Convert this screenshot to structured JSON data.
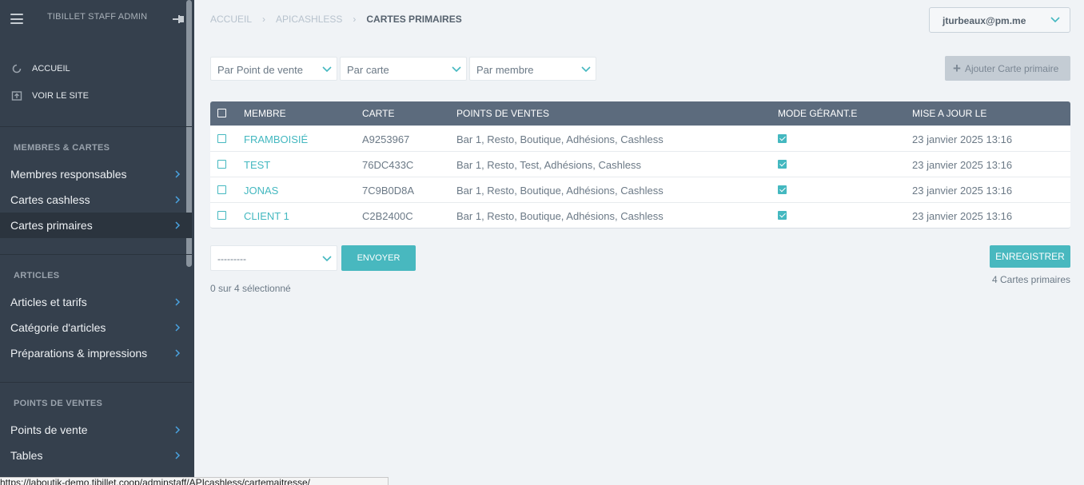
{
  "sidebar": {
    "title": "TIBILLET STAFF ADMIN",
    "links": [
      {
        "label": "ACCUEIL",
        "icon": "refresh-icon"
      },
      {
        "label": "VOIR LE SITE",
        "icon": "external-icon"
      }
    ],
    "sections": [
      {
        "title": "MEMBRES & CARTES",
        "items": [
          "Membres responsables",
          "Cartes cashless",
          "Cartes primaires"
        ]
      },
      {
        "title": "ARTICLES",
        "items": [
          "Articles et tarifs",
          "Catégorie d'articles",
          "Préparations & impressions"
        ]
      },
      {
        "title": "POINTS DE VENTES",
        "items": [
          "Points de vente",
          "Tables"
        ]
      }
    ],
    "active_item": "Cartes primaires"
  },
  "breadcrumb": [
    "ACCUEIL",
    "APICASHLESS",
    "CARTES PRIMAIRES"
  ],
  "user": {
    "email": "jturbeaux@pm.me"
  },
  "filters": [
    "Par Point de vente",
    "Par carte",
    "Par membre"
  ],
  "add_button": "Ajouter Carte primaire",
  "table": {
    "headers": [
      "MEMBRE",
      "CARTE",
      "POINTS DE VENTES",
      "MODE GÉRANT.E",
      "MISE A JOUR LE"
    ],
    "rows": [
      {
        "membre": "FRAMBOISIÉ",
        "carte": "A9253967",
        "points": "Bar 1, Resto, Boutique, Adhésions, Cashless",
        "gerant": true,
        "date": "23 janvier 2025 13:16"
      },
      {
        "membre": "TEST",
        "carte": "76DC433C",
        "points": "Bar 1, Resto, Test, Adhésions, Cashless",
        "gerant": true,
        "date": "23 janvier 2025 13:16"
      },
      {
        "membre": "JONAS",
        "carte": "7C9B0D8A",
        "points": "Bar 1, Resto, Boutique, Adhésions, Cashless",
        "gerant": true,
        "date": "23 janvier 2025 13:16"
      },
      {
        "membre": "CLIENT 1",
        "carte": "C2B2400C",
        "points": "Bar 1, Resto, Boutique, Adhésions, Cashless",
        "gerant": true,
        "date": "23 janvier 2025 13:16"
      }
    ]
  },
  "actions": {
    "select_value": "---------",
    "send_label": "ENVOYER",
    "save_label": "ENREGISTRER",
    "selected_text": "0 sur 4 sélectionné",
    "total_text": "4 Cartes primaires"
  },
  "status_url": "https://laboutik-demo.tibillet.coop/adminstaff/APIcashless/cartemaitresse/",
  "colors": {
    "sidebar": "#35404d",
    "accent": "#48b8bf",
    "table_header": "#5c6b7d"
  }
}
